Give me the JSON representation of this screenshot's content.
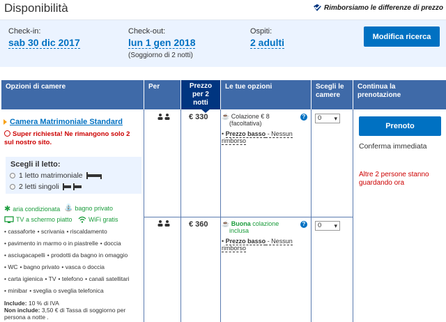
{
  "header": {
    "title": "Disponibilità",
    "promise": "Rimborsiamo le differenze di prezzo"
  },
  "search": {
    "checkin_label": "Check-in:",
    "checkin_value": "sab 30 dic 2017",
    "checkout_label": "Check-out:",
    "checkout_value": "lun 1 gen 2018",
    "stay_note": "(Soggiorno di 2 notti)",
    "guests_label": "Ospiti:",
    "guests_value": "2 adulti",
    "modify_button": "Modifica ricerca"
  },
  "table": {
    "headers": {
      "room_options": "Opzioni di camere",
      "per": "Per",
      "price_line1": "Prezzo",
      "price_line2": "per 2",
      "price_line3": "notti",
      "your_options": "Le tue opzioni",
      "choose_line1": "Scegli le",
      "choose_line2": "camere",
      "continue_line1": "Continua la",
      "continue_line2": "prenotazione"
    },
    "room": {
      "name": "Camera Matrimoniale Standard",
      "urgency": "Super richiesta! Ne rimangono solo 2 sul nostro sito.",
      "bed_title": "Scegli il letto:",
      "bed_option_1": "1 letto matrimoniale",
      "bed_option_2": "2 letti singoli",
      "facilities": {
        "ac": "aria condizionata",
        "bath": "bagno privato",
        "tv": "TV a schermo piatto",
        "wifi": "WiFi gratis"
      },
      "amenities": [
        [
          "cassaforte",
          "scrivania",
          "riscaldamento"
        ],
        [
          "pavimento in marmo o in piastrelle",
          "doccia"
        ],
        [
          "asciugacapelli",
          "prodotti da bagno in omaggio"
        ],
        [
          "WC",
          "bagno privato",
          "vasca o doccia"
        ],
        [
          "carta igienica",
          "TV",
          "telefono",
          "canali satellitari"
        ],
        [
          "minibar",
          "sveglia o sveglia telefonica"
        ]
      ],
      "include_label": "Include:",
      "include_text": "10 % di IVA",
      "not_include_label": "Non include:",
      "not_include_text": "3,50 € di Tassa di soggiorno per persona a notte ."
    },
    "rates": [
      {
        "price": "€ 330",
        "meal_prefix": "",
        "meal": "Colazione € 8",
        "meal_note": "(facoltativa)",
        "low_price": "Prezzo basso",
        "refund": " - Nessun rimborso",
        "qty": "0"
      },
      {
        "price": "€ 360",
        "meal_prefix": "Buona",
        "meal": " colazione",
        "meal_note": "inclusa",
        "low_price": "Prezzo basso",
        "refund": " - Nessun rimborso",
        "qty": "0"
      }
    ],
    "book_button": "Prenoto",
    "confirm_note": "Conferma immediata",
    "others_note": "Altre 2 persone stanno guardando ora"
  },
  "colors": {
    "accent": "#0071c2",
    "header_bg": "#3f6aa8",
    "price_header_bg": "#003580",
    "urgent": "#cc0000",
    "facility_green": "#1b9c3c"
  }
}
